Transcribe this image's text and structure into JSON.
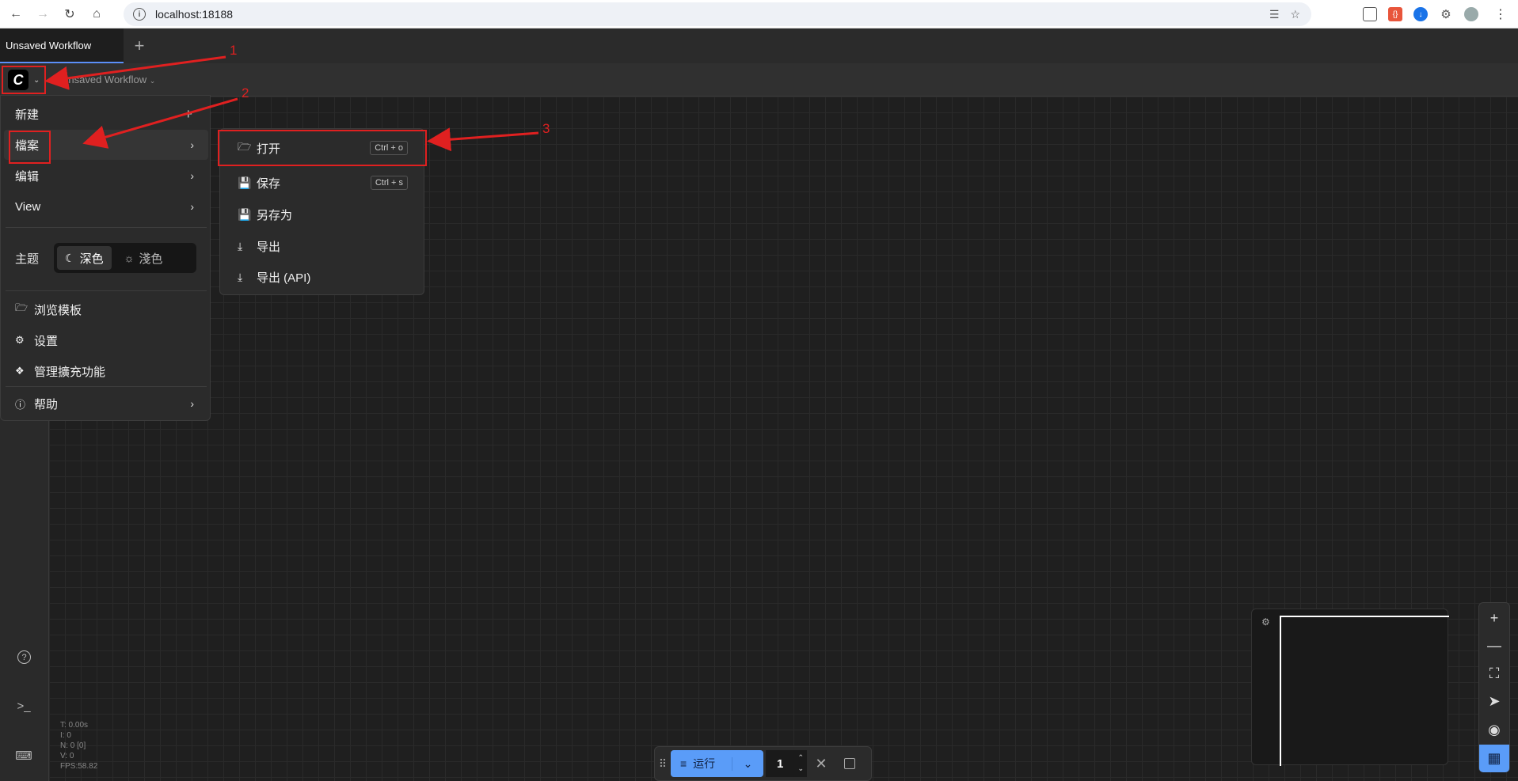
{
  "browser": {
    "url": "localhost:18188"
  },
  "tabs": {
    "active_tab": "Unsaved Workflow",
    "add_label": "+"
  },
  "topbar": {
    "logo_letter": "C",
    "workflow_title": "Unsaved Workflow"
  },
  "main_menu": {
    "items": [
      {
        "label": "新建"
      },
      {
        "label": "檔案"
      },
      {
        "label": "编辑"
      },
      {
        "label": "View"
      }
    ],
    "theme_label": "主题",
    "theme_dark": "深色",
    "theme_light": "淺色",
    "templates": "浏览模板",
    "settings": "设置",
    "extensions": "管理擴充功能",
    "help": "帮助"
  },
  "file_submenu": {
    "items": [
      {
        "label": "打开",
        "shortcut": "Ctrl + o"
      },
      {
        "label": "保存",
        "shortcut": "Ctrl + s"
      },
      {
        "label": "另存为"
      },
      {
        "label": "导出"
      },
      {
        "label": "导出 (API)"
      }
    ]
  },
  "annotations": [
    "1",
    "2",
    "3"
  ],
  "stats": {
    "t": "T: 0.00s",
    "i": "I: 0",
    "n": "N: 0 [0]",
    "v": "V: 0",
    "fps": "FPS:58.82"
  },
  "runbar": {
    "run_label": "运行",
    "batch_count": "1"
  },
  "colors": {
    "accent": "#5a9cf8",
    "annotation": "#e02020"
  }
}
